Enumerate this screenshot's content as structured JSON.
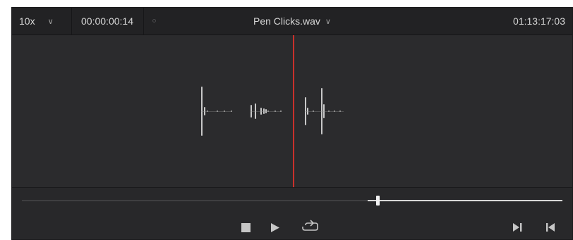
{
  "header": {
    "zoom": "10x",
    "zoom_chevron": "chevron-down-icon",
    "timecode": "00:00:00:14",
    "clip_name": "Pen Clicks.wav",
    "clip_chevron": "chevron-down-icon",
    "timecode_right": "01:13:17:03"
  },
  "viewer": {
    "playhead_color": "#c9302b",
    "background": "#2b2b2d"
  },
  "scrubber": {
    "position_fraction": 0.66
  },
  "transport": {
    "stop_icon": "stop-icon",
    "play_icon": "play-icon",
    "loop_icon": "loop-icon",
    "next_icon": "skip-to-end-icon",
    "prev_icon": "skip-to-start-icon"
  },
  "glyphs": {
    "chevron": "∨"
  }
}
